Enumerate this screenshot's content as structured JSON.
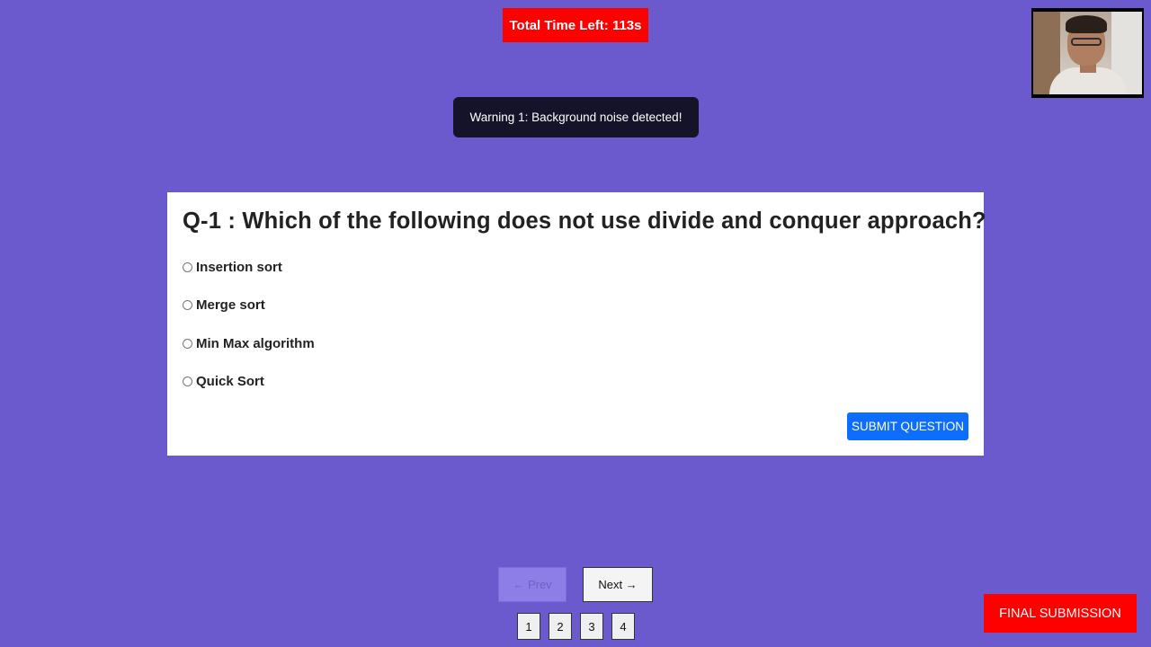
{
  "timer": {
    "label": "Total Time Left: 113s"
  },
  "toast": {
    "message": "Warning 1: Background noise detected!"
  },
  "question": {
    "text": "Q-1 : Which of the following does not use divide and conquer approach?",
    "options": [
      {
        "label": "Insertion sort",
        "selected": false
      },
      {
        "label": "Merge sort",
        "selected": false
      },
      {
        "label": "Min Max algorithm",
        "selected": false
      },
      {
        "label": "Quick Sort",
        "selected": false
      }
    ],
    "submit_label": "SUBMIT QUESTION"
  },
  "navigation": {
    "prev_label": "← Prev",
    "next_label": "Next →",
    "pages": [
      "1",
      "2",
      "3",
      "4"
    ]
  },
  "final_submission_label": "FINAL SUBMISSION",
  "colors": {
    "background": "#6a5acd",
    "timer": "#ff0000",
    "submit": "#0d6efd",
    "final": "#ff0000",
    "toast": "#15132a"
  }
}
